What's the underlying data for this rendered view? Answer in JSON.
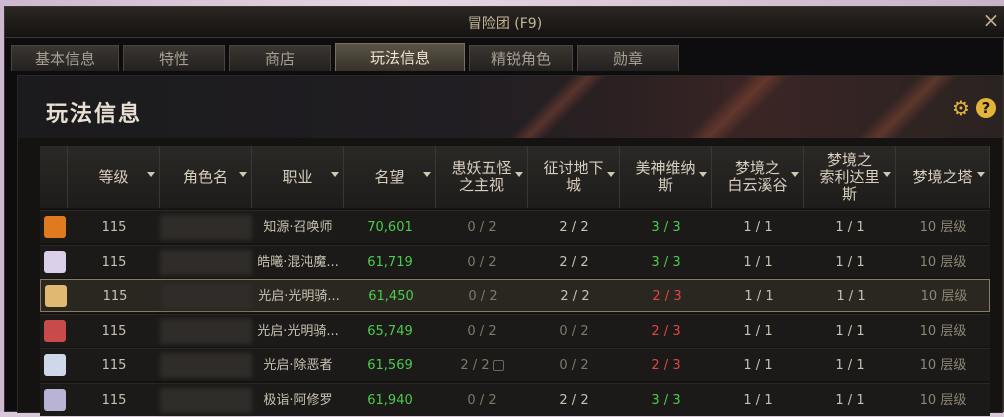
{
  "window": {
    "title": "冒险团 (F9)",
    "close": "×"
  },
  "tabs": [
    {
      "label": "基本信息",
      "active": false
    },
    {
      "label": "特性",
      "active": false
    },
    {
      "label": "商店",
      "active": false
    },
    {
      "label": "玩法信息",
      "active": true
    },
    {
      "label": "精锐角色",
      "active": false
    },
    {
      "label": "勋章",
      "active": false
    }
  ],
  "panel": {
    "title": "玩法信息",
    "settings_icon": "gear-icon",
    "help_icon": "question-icon",
    "help_label": "?"
  },
  "table": {
    "headers": [
      "等级",
      "角色名",
      "职业",
      "名望",
      "患妖五怪之主视",
      "征讨地下城",
      "美神维纳斯",
      "梦境之白云溪谷",
      "梦境之索利达里斯",
      "梦境之塔"
    ],
    "header_lines": [
      [
        "等级"
      ],
      [
        "角色名"
      ],
      [
        "职业"
      ],
      [
        "名望"
      ],
      [
        "患妖五怪",
        "之主视"
      ],
      [
        "征讨地下",
        "城"
      ],
      [
        "美神维纳",
        "斯"
      ],
      [
        "梦境之",
        "白云溪谷"
      ],
      [
        "梦境之",
        "索利达里",
        "斯"
      ],
      [
        "梦境之塔"
      ]
    ],
    "rows": [
      {
        "level": "115",
        "name": "",
        "job": "知源·召唤师",
        "fame": "70,601",
        "c1": "0 / 2",
        "c2": "2 / 2",
        "c3": "3 / 3",
        "c4": "1 / 1",
        "c5": "1 / 1",
        "c6": "10 层级",
        "avatar": "pumpkin-avatar",
        "avatar_color": "#e07a1e",
        "selected": false
      },
      {
        "level": "115",
        "name": "",
        "job": "皓曦·混沌魔...",
        "fame": "61,719",
        "c1": "0 / 2",
        "c2": "2 / 2",
        "c3": "3 / 3",
        "c4": "1 / 1",
        "c5": "1 / 1",
        "c6": "10 层级",
        "avatar": "white-hair-avatar",
        "avatar_color": "#d9cfe8",
        "selected": false
      },
      {
        "level": "115",
        "name": "",
        "job": "光启·光明骑...",
        "fame": "61,450",
        "c1": "0 / 2",
        "c2": "2 / 2",
        "c3": "2 / 3",
        "c4": "1 / 1",
        "c5": "1 / 1",
        "c6": "10 层级",
        "avatar": "blonde-avatar",
        "avatar_color": "#e0b870",
        "selected": true
      },
      {
        "level": "115",
        "name": "",
        "job": "光启·光明骑...",
        "fame": "65,749",
        "c1": "0 / 2",
        "c2": "0 / 2",
        "c3": "2 / 3",
        "c4": "1 / 1",
        "c5": "1 / 1",
        "c6": "10 层级",
        "avatar": "red-hair-avatar",
        "avatar_color": "#c84a4a",
        "selected": false
      },
      {
        "level": "115",
        "name": "",
        "job": "光启·除恶者",
        "fame": "61,569",
        "c1": "2 / 2",
        "c2": "0 / 2",
        "c3": "2 / 3",
        "c4": "1 / 1",
        "c5": "1 / 1",
        "c6": "10 层级",
        "avatar": "cat-ear-avatar",
        "avatar_color": "#cfd8e8",
        "selected": false,
        "c1_locked": true
      },
      {
        "level": "115",
        "name": "",
        "job": "极诣·阿修罗",
        "fame": "61,940",
        "c1": "0 / 2",
        "c2": "2 / 2",
        "c3": "3 / 3",
        "c4": "1 / 1",
        "c5": "1 / 1",
        "c6": "10 层级",
        "avatar": "silver-hair-avatar",
        "avatar_color": "#b9b3d6",
        "selected": false
      }
    ],
    "colors": {
      "complete": "#4ccc4c",
      "incomplete": "#e24545",
      "fame": "#4ccc4c",
      "accent": "#e2b53a"
    }
  }
}
